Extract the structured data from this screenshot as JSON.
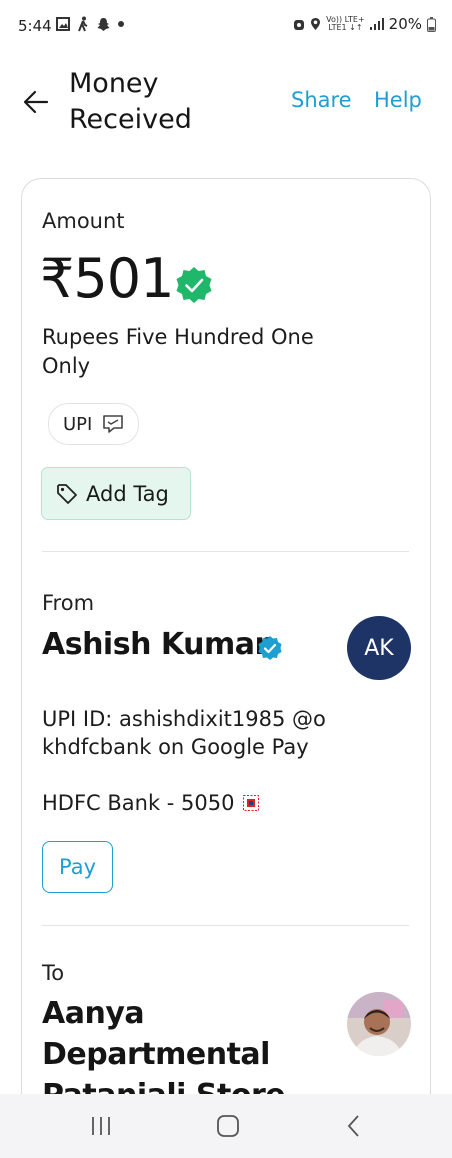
{
  "status_bar": {
    "time": "5:44",
    "network_label_top": "Vo)) LTE+",
    "network_label_bottom": "LTE1 ↓↑",
    "battery": "20%"
  },
  "header": {
    "title": "Money Received",
    "share_label": "Share",
    "help_label": "Help"
  },
  "amount_section": {
    "label": "Amount",
    "value": "₹501",
    "in_words": "Rupees Five Hundred One Only",
    "method_chip": "UPI",
    "add_tag_label": "Add Tag"
  },
  "from_section": {
    "label": "From",
    "name": "Ashish Kumar",
    "avatar_initials": "AK",
    "upi_id": "UPI ID: ashishdixit1985 @okhdfcbank on Google Pay",
    "bank": "HDFC Bank - 5050",
    "pay_label": "Pay"
  },
  "to_section": {
    "label": "To",
    "name": "Aanya Departmental Patanjali Store"
  },
  "colors": {
    "accent": "#1e9ed1",
    "verified_green": "#1fb86b",
    "verified_blue": "#1e9ed1",
    "avatar_bg": "#1f3466",
    "tag_bg": "#e5f6ee"
  }
}
